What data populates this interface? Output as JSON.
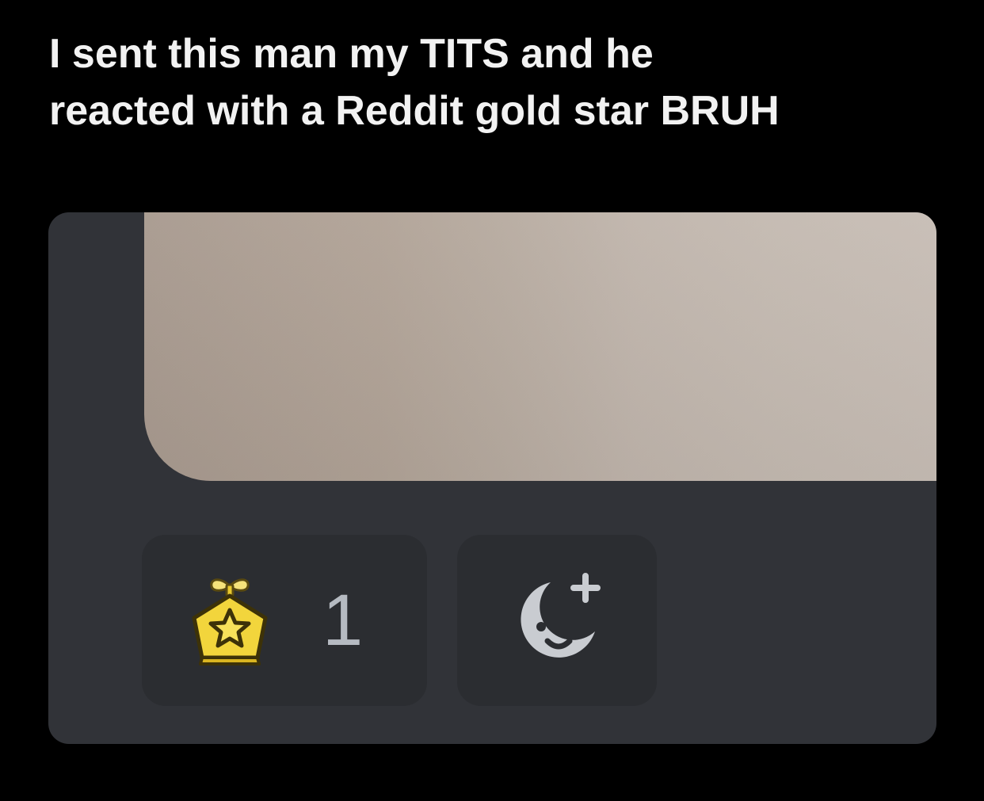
{
  "caption": {
    "line1": "I sent this man my TITS and he",
    "line2": "reacted with a Reddit gold star BRUH"
  },
  "message": {
    "reactions": [
      {
        "icon": "reddit-gold-star-icon",
        "count": "1"
      },
      {
        "icon": "add-reaction-icon"
      }
    ]
  },
  "colors": {
    "background": "#000000",
    "caption_text": "#f2f2f2",
    "card": "#313338",
    "pill": "#2b2d31",
    "count_text": "#b5bac1",
    "gold": "#f2d53c",
    "icon_gray": "#c9ccd1"
  }
}
